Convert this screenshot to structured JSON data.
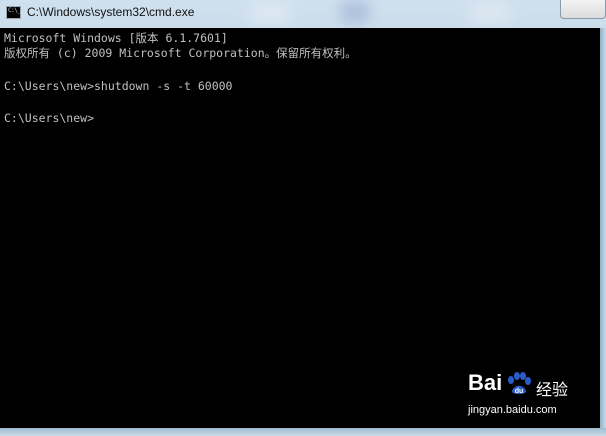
{
  "window": {
    "title": "C:\\Windows\\system32\\cmd.exe"
  },
  "console": {
    "lines": [
      "Microsoft Windows [版本 6.1.7601]",
      "版权所有 (c) 2009 Microsoft Corporation。保留所有权利。",
      "",
      "C:\\Users\\new>shutdown -s -t 60000",
      "",
      "C:\\Users\\new>"
    ]
  },
  "watermark": {
    "brand": "Bai",
    "service": "经验",
    "url": "jingyan.baidu.com"
  },
  "colors": {
    "console_bg": "#000000",
    "console_text": "#c0c0c0",
    "baidu_paw": "#2a5cc9"
  }
}
